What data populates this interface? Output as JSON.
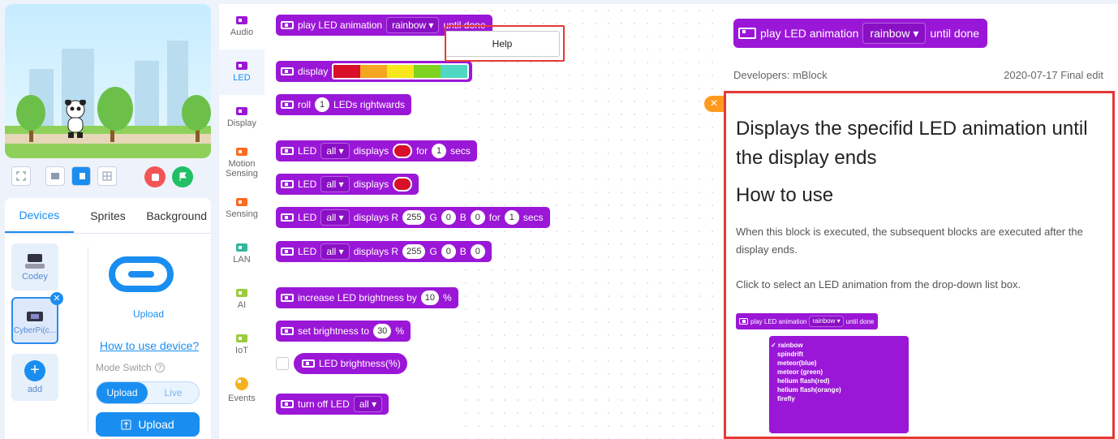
{
  "stage_controls": {
    "icons": [
      "fullscreen-icon",
      "small-stage-icon",
      "large-stage-icon",
      "grid-icon"
    ],
    "stop_color": "#f25555",
    "go_color": "#21c066"
  },
  "device_panel": {
    "tabs": [
      "Devices",
      "Sprites",
      "Background"
    ],
    "devices": [
      {
        "label": "Codey"
      },
      {
        "label": "CyberPi(c..."
      }
    ],
    "add_label": "add",
    "upload_label": "Upload",
    "how_to_use": "How to use device?",
    "mode_switch": "Mode Switch",
    "mode_upload": "Upload",
    "mode_live": "Live",
    "upload_button": "Upload"
  },
  "categories": [
    {
      "label": "Audio",
      "color": "#9b17d7"
    },
    {
      "label": "LED",
      "color": "#9b17d7"
    },
    {
      "label": "Display",
      "color": "#9b17d7"
    },
    {
      "label": "Motion Sensing",
      "color": "#ff6a1f"
    },
    {
      "label": "Sensing",
      "color": "#ff6a1f"
    },
    {
      "label": "LAN",
      "color": "#2fb89b"
    },
    {
      "label": "AI",
      "color": "#9ccc3c"
    },
    {
      "label": "IoT",
      "color": "#9ccc3c"
    },
    {
      "label": "Events",
      "color": "#f5b21e"
    }
  ],
  "blocks": {
    "b1": {
      "text": "play LED animation",
      "dd": "rainbow ▾",
      "tail": "until done"
    },
    "b2": {
      "text": "display",
      "colors": [
        "#d8102a",
        "#f5a623",
        "#f8e71c",
        "#7ed321",
        "#4fd8c4"
      ]
    },
    "b3": {
      "text": "roll",
      "val": "1",
      "tail": "LEDs rightwards"
    },
    "b4": {
      "text": "LED",
      "dd": "all ▾",
      "mid": "displays",
      "for": "for",
      "val": "1",
      "tail": "secs"
    },
    "b5": {
      "text": "LED",
      "dd": "all ▾",
      "mid": "displays"
    },
    "b6": {
      "text": "LED",
      "dd": "all ▾",
      "mid": "displays R",
      "r": "255",
      "g_label": "G",
      "g": "0",
      "b_label": "B",
      "b": "0",
      "for": "for",
      "val": "1",
      "tail": "secs"
    },
    "b7": {
      "text": "LED",
      "dd": "all ▾",
      "mid": "displays R",
      "r": "255",
      "g_label": "G",
      "g": "0",
      "b_label": "B",
      "b": "0"
    },
    "b8": {
      "text": "increase LED brightness by",
      "val": "10",
      "tail": "%"
    },
    "b9": {
      "text": "set brightness to",
      "val": "30",
      "tail": "%"
    },
    "b10": {
      "text": "LED brightness(%)"
    },
    "b11": {
      "text": "turn off LED",
      "dd": "all ▾"
    }
  },
  "context_menu": {
    "help": "Help"
  },
  "help": {
    "block_text": "play LED animation",
    "block_dd": "rainbow ▾",
    "block_tail": "until done",
    "developers": "Developers: mBlock",
    "date": "2020-07-17 Final edit",
    "title": "Displays the specifid LED animation until the display ends",
    "howto": "How to use",
    "p1": "When this block is executed, the subsequent blocks are executed after the display ends.",
    "p2": "Click to select an LED animation from the drop-down list box.",
    "mini_text": "play LED animation",
    "mini_dd": "rainbow ▾",
    "mini_tail": "until done",
    "options": [
      "rainbow",
      "spindrift",
      "meteor(blue)",
      "meteor (green)",
      "helium flash(red)",
      "helium flash(orange)",
      "firefly"
    ]
  }
}
